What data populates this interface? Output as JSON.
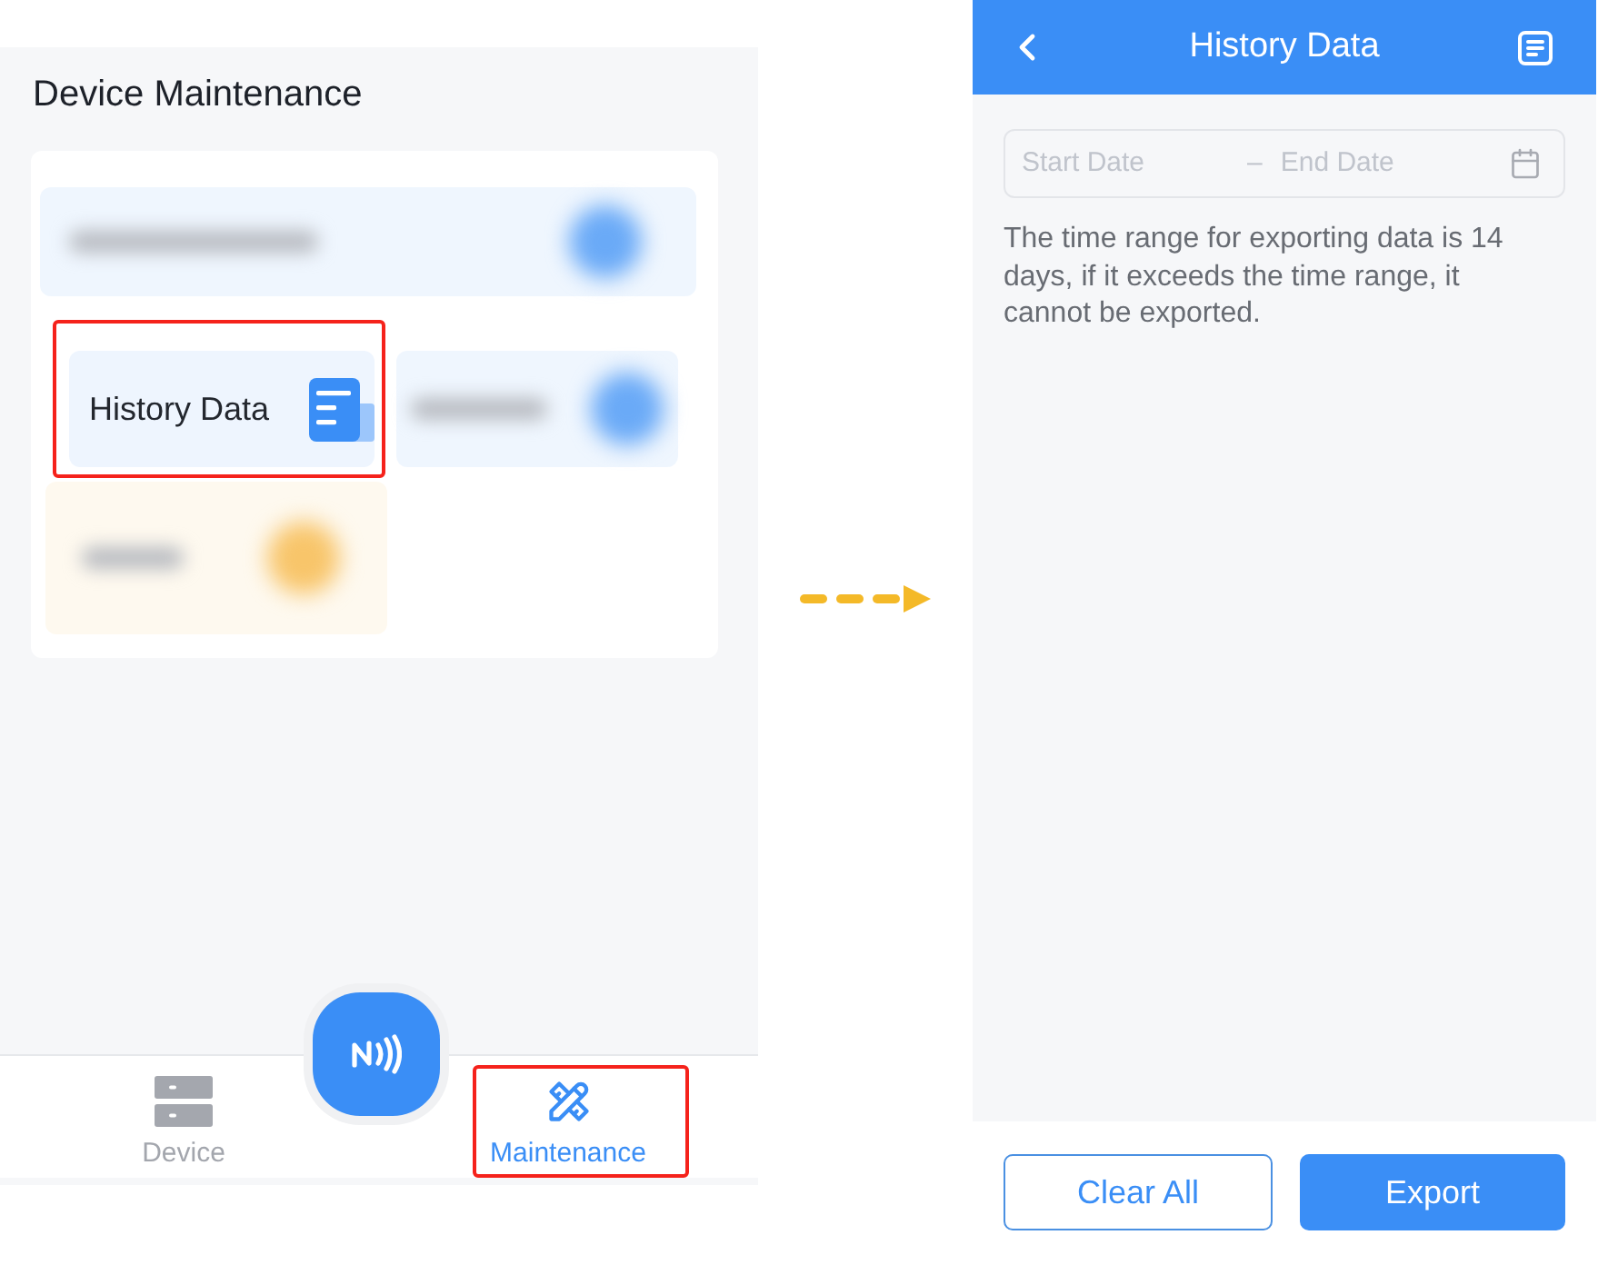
{
  "left_screen": {
    "title": "Device Maintenance",
    "tiles": [
      {
        "kind": "blurred",
        "color": "#6aaaf7"
      },
      {
        "kind": "item",
        "label": "History Data",
        "highlighted": true
      },
      {
        "kind": "blurred",
        "color": "#6aaaf7"
      },
      {
        "kind": "blurred",
        "color": "#f8c56a"
      }
    ],
    "tab_bar": [
      {
        "label": "Device",
        "selected": false,
        "highlighted": false
      },
      {
        "label": "Maintenance",
        "selected": true,
        "highlighted": true
      }
    ]
  },
  "right_screen": {
    "header": {
      "title": "History Data"
    },
    "date_range": {
      "start_placeholder": "Start Date",
      "separator": "–",
      "end_placeholder": "End Date"
    },
    "note": "The time range for exporting data is 14 days, if it exceeds the time range, it cannot be exported.",
    "buttons": [
      {
        "label": "Clear All",
        "kind": "outline"
      },
      {
        "label": "Export",
        "kind": "primary"
      }
    ]
  }
}
